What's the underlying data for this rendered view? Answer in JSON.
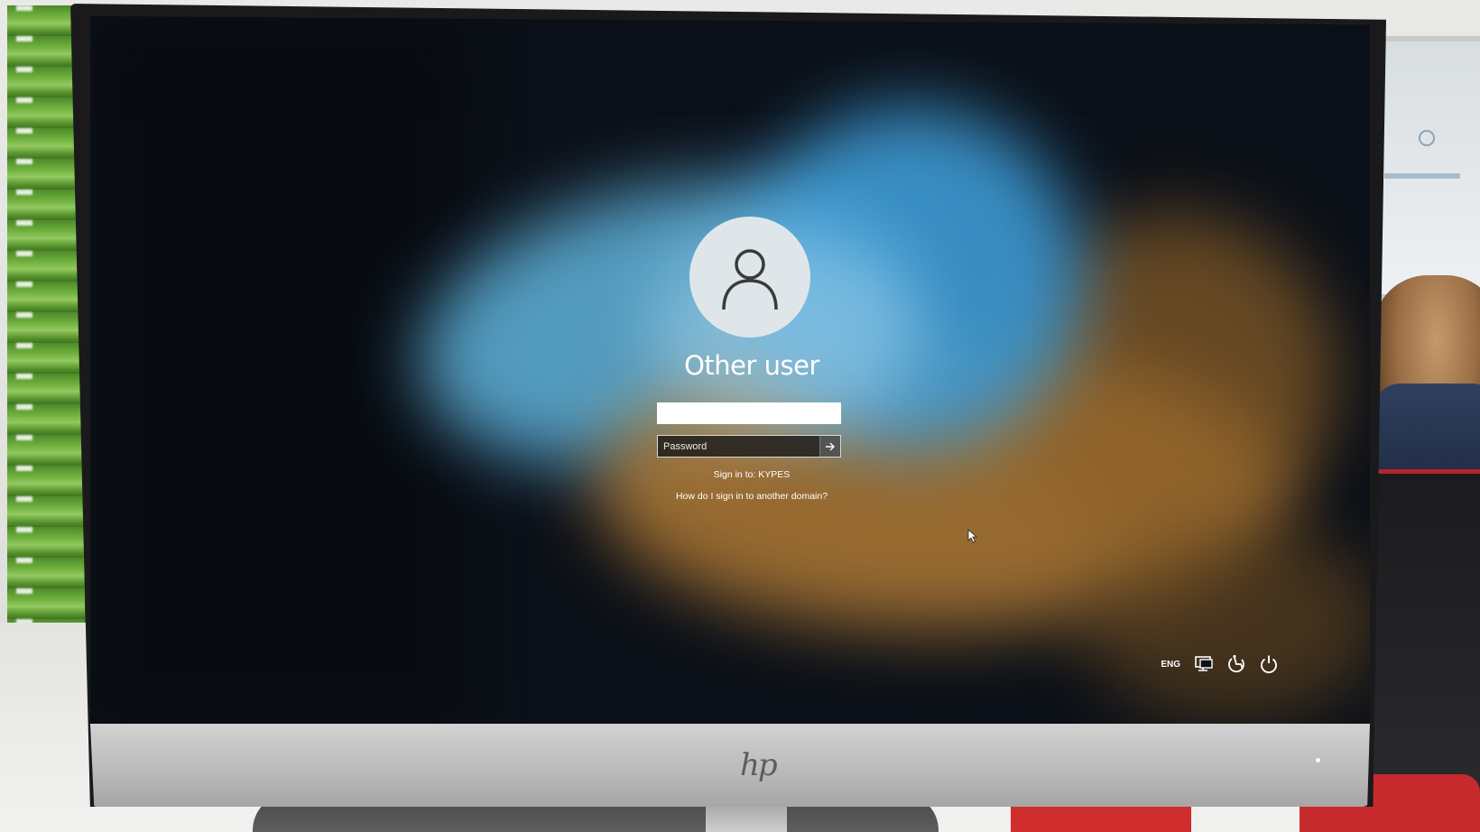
{
  "login": {
    "username": "Other user",
    "user_field_value": "",
    "password_placeholder": "Password",
    "sign_in_to": "Sign in to: KYPES",
    "domain_help_link": "How do I sign in to another domain?"
  },
  "tray": {
    "language": "ENG",
    "icons": [
      "network-icon",
      "accessibility-icon",
      "power-icon"
    ]
  },
  "monitor": {
    "brand_logo": "hp"
  },
  "colors": {
    "text": "#ffffff",
    "avatar_bg": "#dfe6ea",
    "wallpaper_blue": "#3d9ad4",
    "wallpaper_amber": "#b07a35"
  }
}
